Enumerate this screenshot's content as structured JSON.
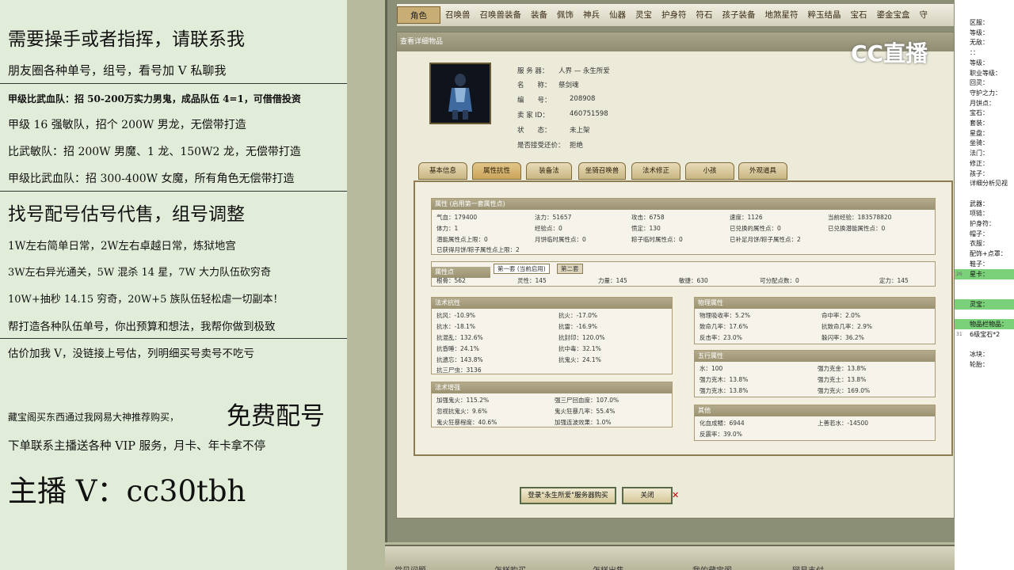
{
  "left_overlay": {
    "lines": [
      "需要操手或者指挥，请联系我",
      "朋友圈各种单号，组号，看号加 V 私聊我",
      "甲级比武血队：招 50-200万实力男鬼，成品队伍 4=1，可借借投资",
      "甲级 16 强敏队，招个 200W 男龙，无偿带打造",
      "比武敏队：招 200W 男魔、1 龙、150W2 龙，无偿带打造",
      "甲级比武血队：招 300-400W 女魔，所有角色无偿带打造",
      "找号配号估号代售，组号调整",
      "1W左右简单日常，2W左右卓越日常，炼狱地宫",
      "3W左右异光通关，5W 混杀 14 星，7W 大力队伍砍穷奇",
      "10W+抽秒 14.15 穷奇，20W+5 族队伍轻松虐一切副本！",
      "帮打造各种队伍单号，你出预算和想法，我帮你做到极致",
      "估价加我 V，没链接上号估，列明细买号卖号不吃亏",
      "藏宝阁买东西通过我网易大神推荐购买，",
      "免费配号",
      "下单联系主播送各种 VIP 服务，月卡、年卡拿不停",
      "主播 V：cc30tbh"
    ]
  },
  "game": {
    "top_tabs": [
      "角色",
      "召唤兽",
      "召唤兽装备",
      "装备",
      "佩饰",
      "神兵",
      "仙器",
      "灵宝",
      "护身符",
      "符石",
      "孩子装备",
      "地煞星符",
      "粹玉结晶",
      "宝石",
      "鎏金宝盒",
      "守"
    ],
    "active_tab": "角色",
    "panel_title": "查看详细物品",
    "info": {
      "server_label": "服 务 器：",
      "server": "人界 — 永生所爱",
      "name_label": "名　　称：",
      "name": "祭剑魂",
      "id_label": "编　　号：",
      "id": "208908",
      "seller_label": "卖 家 ID：",
      "seller": "460751598",
      "status_label": "状　　态：",
      "status": "未上架",
      "bargain_label": "是否接受还价：",
      "bargain": "拒绝"
    },
    "sub_tabs": [
      "基本信息",
      "属性抗性",
      "装备法",
      "坐骑召唤兽",
      "法术修正",
      "小孩",
      "外观道具"
    ],
    "active_sub_tab": "属性抗性",
    "attr": {
      "title": "属性 (启用第一套属性点)",
      "rows": [
        [
          "气血：179400",
          "法力：51657",
          "攻击：6758",
          "速度：1126",
          "当前经验：183578820"
        ],
        [
          "体力：1",
          "经验点：0",
          "愤定：130",
          "已兑换的属性点：0",
          "已兑换潜能属性点：0"
        ],
        [
          "潜能属性点上限：0",
          "月饼临时属性点：0",
          "粽子临时属性点：0",
          "已补足月饼/粽子属性点：2",
          ""
        ]
      ],
      "note": "已获得月饼/粽子属性点上限：2"
    },
    "points": {
      "title": "属性点",
      "tab1": "第一套 (当前启用)",
      "tab2": "第二套",
      "values": [
        "根骨：562",
        "灵性：145",
        "力量：145",
        "敏捷：630",
        "可分配点数：0",
        "定力：145"
      ]
    },
    "spell_resist": {
      "title": "法术抗性",
      "items": [
        [
          "抗风：-10.9%",
          "抗火：-17.0%"
        ],
        [
          "抗水：-18.1%",
          "抗雷：-16.9%"
        ],
        [
          "抗混乱：132.6%",
          "抗封印：120.0%"
        ],
        [
          "抗昏睡：24.1%",
          "抗中毒：32.1%"
        ],
        [
          "抗遗忘：143.8%",
          "抗鬼火：24.1%"
        ],
        [
          "抗三尸虫：3136",
          ""
        ]
      ]
    },
    "spell_boost": {
      "title": "法术增强",
      "items": [
        [
          "加强鬼火：115.2%",
          "强三尸回血度：107.0%"
        ],
        [
          "忽视抗鬼火：9.6%",
          "鬼火狂暴几率：55.4%"
        ],
        [
          "鬼火狂暴程度：40.6%",
          "加强连波效果：1.0%"
        ]
      ]
    },
    "physical": {
      "title": "物理属性",
      "items": [
        [
          "物理吸收率：5.2%",
          "命中率：2.0%"
        ],
        [
          "致命几率：17.6%",
          "抗致命几率：2.9%"
        ],
        [
          "反击率：23.0%",
          "躲闪率：36.2%"
        ]
      ]
    },
    "five_elements": {
      "title": "五行属性",
      "items": [
        [
          "水：100",
          "强力克金：13.8%"
        ],
        [
          "强力克木：13.8%",
          "强力克土：13.8%"
        ],
        [
          "强力克水：13.8%",
          "强力克火：169.0%"
        ]
      ]
    },
    "other": {
      "title": "其他",
      "items": [
        [
          "化血成鳍：6944",
          "上善若水：-14500"
        ],
        [
          "反震率：39.0%",
          ""
        ]
      ]
    },
    "buttons": {
      "login": "登录\"永生所爱\"服务器购买",
      "close": "关闭"
    },
    "x_mark": "✕",
    "bottom_bar": [
      "常见问题",
      "怎样购买",
      "怎样出售",
      "我的藏宝阁",
      "网易支付"
    ],
    "logo": "CC直播"
  },
  "sheet": {
    "rows": [
      {
        "n": "",
        "t": "区服："
      },
      {
        "n": "",
        "t": "等级："
      },
      {
        "n": "",
        "t": "无敌："
      },
      {
        "n": "",
        "t": "：："
      },
      {
        "n": "",
        "t": "等级："
      },
      {
        "n": "",
        "t": "职业等级："
      },
      {
        "n": "",
        "t": "回灵："
      },
      {
        "n": "",
        "t": "守护之力："
      },
      {
        "n": "",
        "t": "月饼点："
      },
      {
        "n": "",
        "t": "宝石："
      },
      {
        "n": "",
        "t": "套装："
      },
      {
        "n": "",
        "t": "星盘："
      },
      {
        "n": "",
        "t": "坐骑："
      },
      {
        "n": "",
        "t": "法门："
      },
      {
        "n": "",
        "t": "修正："
      },
      {
        "n": "",
        "t": "孩子："
      },
      {
        "n": "",
        "t": "详细分析见视"
      },
      {
        "n": "",
        "t": ""
      },
      {
        "n": "",
        "t": "武器："
      },
      {
        "n": "",
        "t": "项链："
      },
      {
        "n": "",
        "t": "护身符："
      },
      {
        "n": "",
        "t": "帽子："
      },
      {
        "n": "",
        "t": "衣服："
      },
      {
        "n": "",
        "t": "配饰+点罩："
      },
      {
        "n": "",
        "t": "鞋子："
      },
      {
        "n": "26",
        "t": "星卡："
      },
      {
        "n": "",
        "t": ""
      },
      {
        "n": "",
        "t": ""
      },
      {
        "n": "",
        "t": "灵宝："
      },
      {
        "n": "",
        "t": ""
      },
      {
        "n": "",
        "t": "物品栏物品："
      },
      {
        "n": "31",
        "t": "6级宝石*2"
      },
      {
        "n": "",
        "t": ""
      },
      {
        "n": "",
        "t": "冰块："
      },
      {
        "n": "",
        "t": "轮胎："
      }
    ],
    "highlight_rows": [
      25,
      28,
      30
    ]
  }
}
